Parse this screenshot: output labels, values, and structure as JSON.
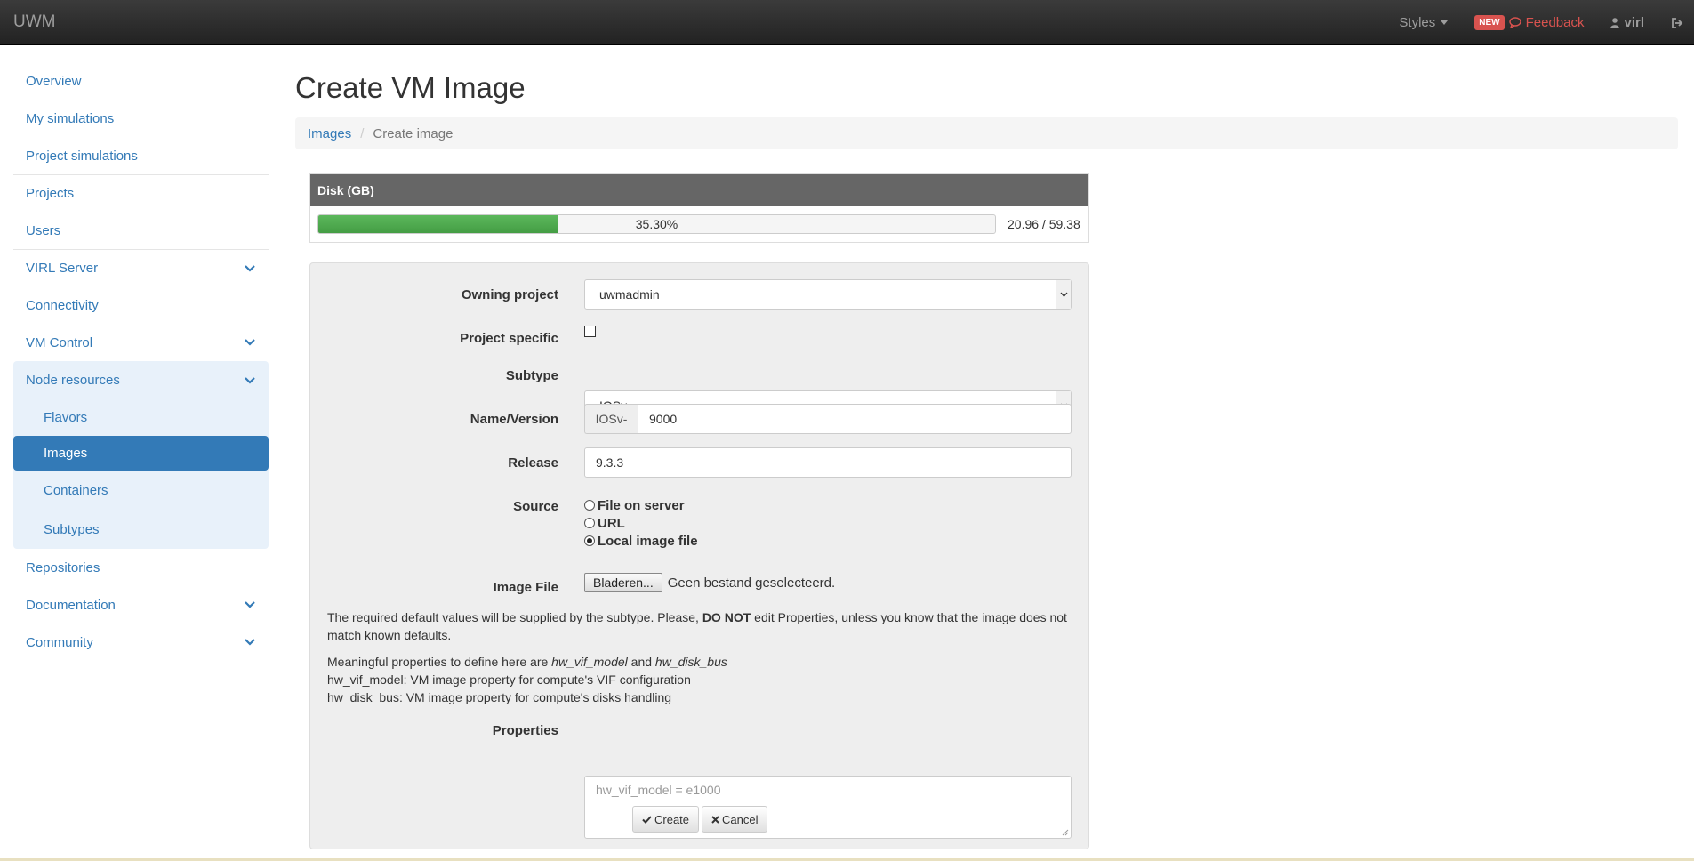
{
  "navbar": {
    "brand": "UWM",
    "styles_label": "Styles",
    "badge": "NEW",
    "feedback_label": "Feedback",
    "user": "virl"
  },
  "sidebar": {
    "items": [
      "Overview",
      "My simulations",
      "Project simulations",
      "Projects",
      "Users",
      "VIRL Server",
      "Connectivity",
      "VM Control",
      "Node resources",
      "Repositories",
      "Documentation",
      "Community"
    ],
    "subitems": [
      "Flavors",
      "Images",
      "Containers",
      "Subtypes"
    ]
  },
  "page": {
    "title": "Create VM Image",
    "breadcrumb": [
      "Images",
      "Create image"
    ]
  },
  "disk": {
    "header": "Disk (GB)",
    "percent_label": "35.30%",
    "fraction": 0.353,
    "usage": "20.96 / 59.38"
  },
  "form": {
    "owning_project_label": "Owning project",
    "owning_project_value": "uwmadmin",
    "project_specific_label": "Project specific",
    "subtype_label": "Subtype",
    "subtype_value": "IOSv",
    "name_label": "Name/Version",
    "name_prefix": "IOSv-",
    "name_value": "9000",
    "release_label": "Release",
    "release_value": "9.3.3",
    "source_label": "Source",
    "source_options": [
      "File on server",
      "URL",
      "Local image file"
    ],
    "image_file_label": "Image File",
    "browse_label": "Bladeren...",
    "no_file_text": "Geen bestand geselecteerd.",
    "help1_a": "The required default values will be supplied by the subtype. Please, ",
    "help1_b": "DO NOT",
    "help1_c": " edit Properties, unless you know that the image does not match known defaults.",
    "help2_a": "Meaningful properties to define here are ",
    "help2_b": "hw_vif_model",
    "help2_c": " and ",
    "help2_d": "hw_disk_bus",
    "help3": "hw_vif_model: VM image property for compute's VIF configuration",
    "help4": "hw_disk_bus: VM image property for compute's disks handling",
    "properties_label": "Properties",
    "properties_placeholder": "hw_vif_model = e1000",
    "create_label": "Create",
    "cancel_label": "Cancel"
  }
}
